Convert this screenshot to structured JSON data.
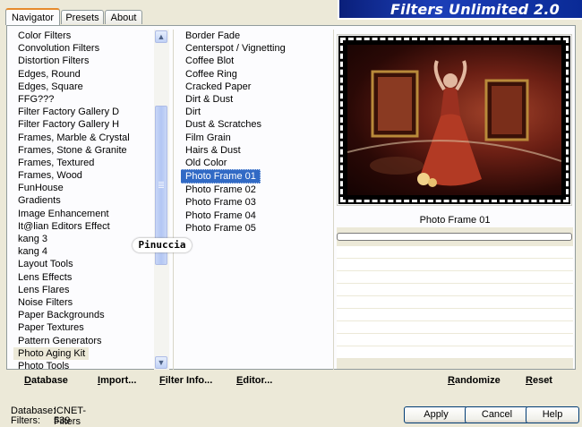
{
  "tabs": [
    {
      "label": "Navigator",
      "active": true
    },
    {
      "label": "Presets",
      "active": false
    },
    {
      "label": "About",
      "active": false
    }
  ],
  "app_title": "Filters Unlimited 2.0",
  "categories": [
    "Color Filters",
    "Convolution Filters",
    "Distortion Filters",
    "Edges, Round",
    "Edges, Square",
    "FFG???",
    "Filter Factory Gallery D",
    "Filter Factory Gallery H",
    "Frames, Marble & Crystal",
    "Frames, Stone & Granite",
    "Frames, Textured",
    "Frames, Wood",
    "FunHouse",
    "Gradients",
    "Image Enhancement",
    "It@lian Editors Effect",
    "kang 3",
    "kang 4",
    "Layout Tools",
    "Lens Effects",
    "Lens Flares",
    "Noise Filters",
    "Paper Backgrounds",
    "Paper Textures",
    "Pattern Generators",
    "Photo Aging Kit",
    "Photo Tools"
  ],
  "highlighted_category": "Photo Aging Kit",
  "filters": [
    "Border Fade",
    "Centerspot / Vignetting",
    "Coffee Blot",
    "Coffee Ring",
    "Cracked Paper",
    "Dirt & Dust",
    "Dirt",
    "Dust & Scratches",
    "Film Grain",
    "Hairs & Dust",
    "Old Color",
    "Photo Frame 01",
    "Photo Frame 02",
    "Photo Frame 03",
    "Photo Frame 04",
    "Photo Frame 05"
  ],
  "selected_filter": "Photo Frame 01",
  "preview_label": "Photo Frame 01",
  "watermark": "Pinuccia",
  "bottom_links": {
    "database": "Database",
    "import": "Import...",
    "filter_info": "Filter Info...",
    "editor": "Editor...",
    "randomize": "Randomize",
    "reset": "Reset"
  },
  "status": {
    "database_label": "Database:",
    "database_value": "ICNET-Filters",
    "filters_label": "Filters:",
    "filters_value": "539"
  },
  "buttons": {
    "apply": "Apply",
    "cancel": "Cancel",
    "help": "Help"
  },
  "colors": {
    "selection": "#316ac5",
    "banner": "#0a1f7a",
    "tab_accent": "#e68b2c"
  }
}
